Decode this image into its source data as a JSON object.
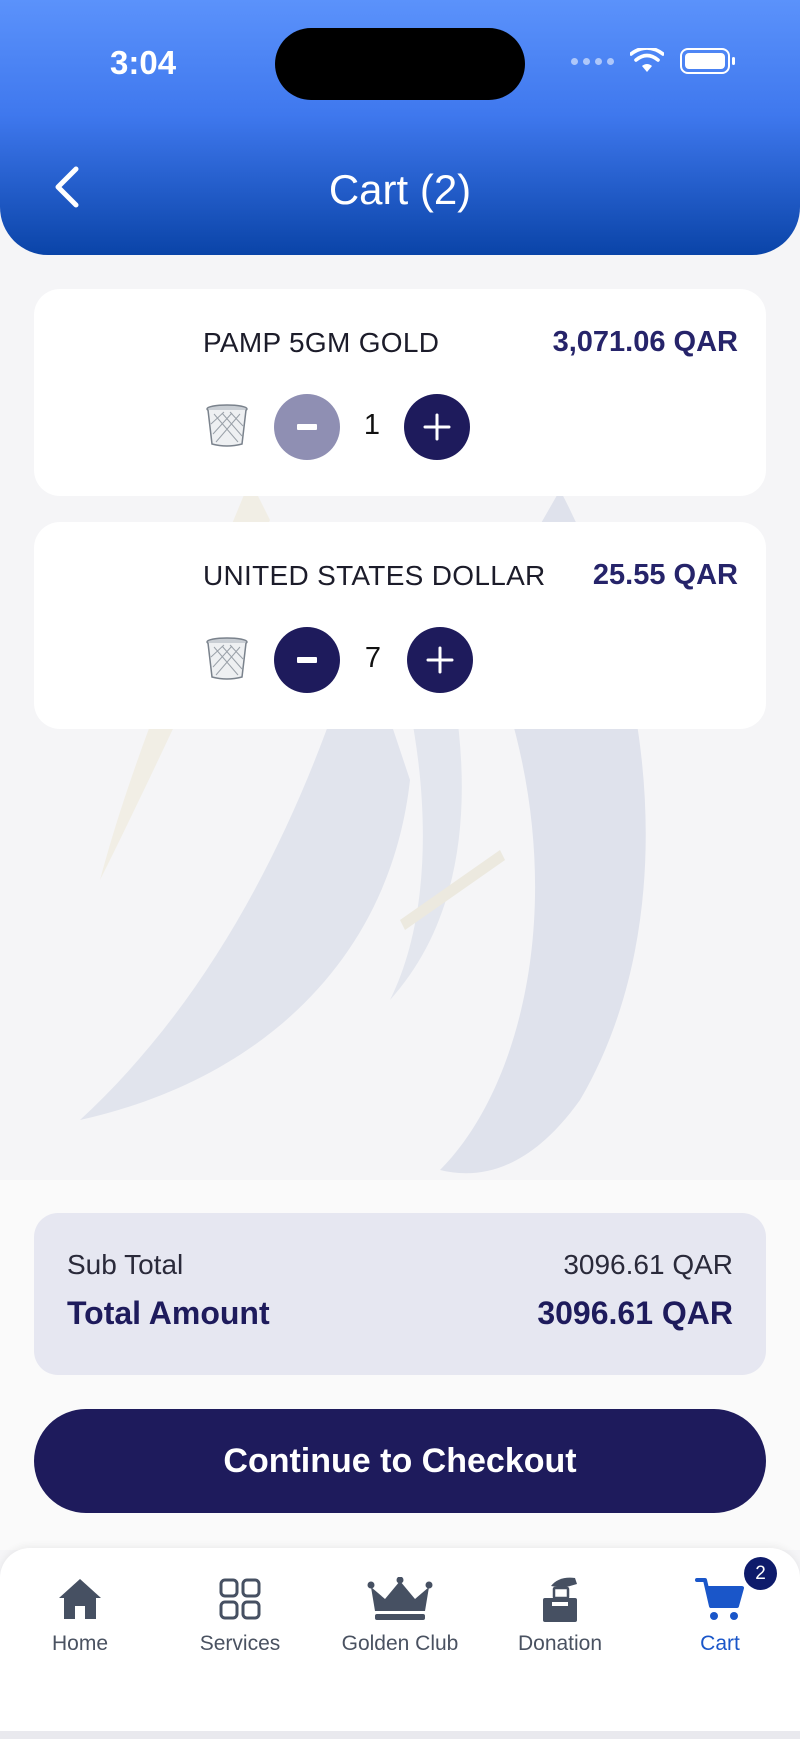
{
  "status_bar": {
    "time": "3:04"
  },
  "header": {
    "title": "Cart (2)"
  },
  "cart_items": [
    {
      "name": "PAMP 5GM GOLD",
      "price": "3,071.06 QAR",
      "quantity": "1"
    },
    {
      "name": "UNITED STATES DOLLAR",
      "price": "25.55 QAR",
      "quantity": "7"
    }
  ],
  "summary": {
    "sub_total_label": "Sub Total",
    "sub_total_value": "3096.61 QAR",
    "total_label": "Total Amount",
    "total_value": "3096.61 QAR"
  },
  "checkout": {
    "label": "Continue to Checkout"
  },
  "tabbar": {
    "items": [
      {
        "label": "Home",
        "icon": "home-icon"
      },
      {
        "label": "Services",
        "icon": "grid-icon"
      },
      {
        "label": "Golden Club",
        "icon": "crown-icon"
      },
      {
        "label": "Donation",
        "icon": "donation-icon"
      },
      {
        "label": "Cart",
        "icon": "cart-icon"
      }
    ],
    "active": "Cart",
    "cart_badge": "2"
  },
  "colors": {
    "primary": "#1e1b5c",
    "header_top": "#5b92fb",
    "header_bottom": "#0a44a8",
    "active_tab": "#1a56c9"
  }
}
